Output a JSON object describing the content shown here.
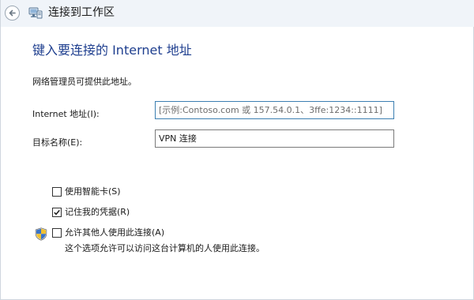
{
  "window": {
    "title": "连接到工作区",
    "back_icon": "back-arrow-icon",
    "title_icon": "network-workplace-icon"
  },
  "main": {
    "heading": "键入要连接的 Internet 地址",
    "note": "网络管理员可提供此地址。",
    "internet_address": {
      "label": "Internet 地址(I):",
      "value": "",
      "placeholder": "[示例:Contoso.com 或 157.54.0.1、3ffe:1234::1111]"
    },
    "destination_name": {
      "label": "目标名称(E):",
      "value": "VPN 连接"
    },
    "options": {
      "smart_card": {
        "label": "使用智能卡(S)",
        "checked": false
      },
      "remember_credentials": {
        "label": "记住我的凭据(R)",
        "checked": true
      },
      "allow_others": {
        "label": "允许其他人使用此连接(A)",
        "checked": false,
        "icon": "uac-shield-icon"
      }
    },
    "allow_others_description": "这个选项允许可以访问这台计算机的人使用此连接。"
  },
  "colors": {
    "heading": "#1f3f8f",
    "titlebar_bg": "#f0f4f9",
    "active_input_border": "#3c7fb1"
  }
}
